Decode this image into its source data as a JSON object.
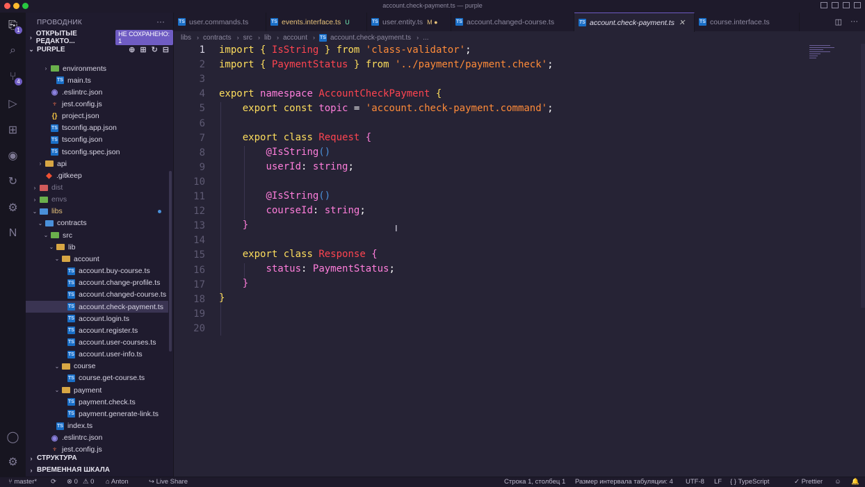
{
  "window": {
    "title": "account.check-payment.ts — purple"
  },
  "activity": {
    "items": [
      {
        "icon": "files-icon",
        "badge": "1"
      },
      {
        "icon": "search-icon"
      },
      {
        "icon": "source-control-icon",
        "badge": "4"
      },
      {
        "icon": "run-debug-icon"
      },
      {
        "icon": "extensions-icon"
      },
      {
        "icon": "github-icon"
      },
      {
        "icon": "remote-icon"
      },
      {
        "icon": "settings-sync-icon"
      },
      {
        "icon": "nx-icon"
      }
    ],
    "bottom": [
      {
        "icon": "account-icon"
      },
      {
        "icon": "manage-gear-icon"
      }
    ]
  },
  "sidebar": {
    "title": "ПРОВОДНИК",
    "more": "···",
    "open_editors": {
      "label": "ОТКРЫТЫЕ РЕДАКТО...",
      "badge": "НЕ СОХРАНЕНО: 1"
    },
    "workspace": {
      "label": "PURPLE"
    },
    "tree": [
      {
        "name": "environments",
        "type": "folder",
        "color": "green",
        "indent": 2,
        "twisty": "›"
      },
      {
        "name": "main.ts",
        "type": "ts",
        "indent": 3
      },
      {
        "name": ".eslintrc.json",
        "type": "eslint",
        "indent": 2
      },
      {
        "name": "jest.config.js",
        "type": "js",
        "indent": 2
      },
      {
        "name": "project.json",
        "type": "json",
        "indent": 2
      },
      {
        "name": "tsconfig.app.json",
        "type": "ts",
        "indent": 2
      },
      {
        "name": "tsconfig.json",
        "type": "ts",
        "indent": 2
      },
      {
        "name": "tsconfig.spec.json",
        "type": "ts",
        "indent": 2
      },
      {
        "name": "api",
        "type": "folder",
        "color": "",
        "indent": 1,
        "twisty": "›"
      },
      {
        "name": ".gitkeep",
        "type": "git",
        "indent": 1
      },
      {
        "name": "dist",
        "type": "folder",
        "color": "red",
        "indent": 0,
        "twisty": "›",
        "dim": true
      },
      {
        "name": "envs",
        "type": "folder",
        "color": "green",
        "indent": 0,
        "twisty": "›",
        "dim": true
      },
      {
        "name": "libs",
        "type": "folder",
        "color": "blue",
        "indent": 0,
        "twisty": "⌄",
        "mod": true,
        "dot": true
      },
      {
        "name": "contracts",
        "type": "folder",
        "color": "blue",
        "indent": 1,
        "twisty": "⌄"
      },
      {
        "name": "src",
        "type": "folder",
        "color": "green",
        "indent": 2,
        "twisty": "⌄"
      },
      {
        "name": "lib",
        "type": "folder",
        "color": "",
        "indent": 3,
        "twisty": "⌄"
      },
      {
        "name": "account",
        "type": "folder",
        "color": "",
        "indent": 4,
        "twisty": "⌄"
      },
      {
        "name": "account.buy-course.ts",
        "type": "ts",
        "indent": 5
      },
      {
        "name": "account.change-profile.ts",
        "type": "ts",
        "indent": 5
      },
      {
        "name": "account.changed-course.ts",
        "type": "ts",
        "indent": 5
      },
      {
        "name": "account.check-payment.ts",
        "type": "ts",
        "indent": 5,
        "selected": true
      },
      {
        "name": "account.login.ts",
        "type": "ts",
        "indent": 5
      },
      {
        "name": "account.register.ts",
        "type": "ts",
        "indent": 5
      },
      {
        "name": "account.user-courses.ts",
        "type": "ts",
        "indent": 5
      },
      {
        "name": "account.user-info.ts",
        "type": "ts",
        "indent": 5
      },
      {
        "name": "course",
        "type": "folder",
        "color": "",
        "indent": 4,
        "twisty": "⌄"
      },
      {
        "name": "course.get-course.ts",
        "type": "ts",
        "indent": 5
      },
      {
        "name": "payment",
        "type": "folder",
        "color": "",
        "indent": 4,
        "twisty": "⌄"
      },
      {
        "name": "payment.check.ts",
        "type": "ts",
        "indent": 5
      },
      {
        "name": "payment.generate-link.ts",
        "type": "ts",
        "indent": 5
      },
      {
        "name": "index.ts",
        "type": "ts",
        "indent": 3
      },
      {
        "name": ".eslintrc.json",
        "type": "eslint",
        "indent": 2
      },
      {
        "name": "jest.config.js",
        "type": "js",
        "indent": 2
      }
    ],
    "outline": "СТРУКТУРА",
    "timeline": "ВРЕМЕННАЯ ШКАЛА"
  },
  "tabs": [
    {
      "label": "user.commands.ts",
      "flag": ""
    },
    {
      "label": "events.interface.ts",
      "flag": "U",
      "flag_class": "u"
    },
    {
      "label": "user.entity.ts",
      "flag": "M ●",
      "flag_class": "m"
    },
    {
      "label": "account.changed-course.ts",
      "flag": ""
    },
    {
      "label": "account.check-payment.ts",
      "flag": "✕",
      "flag_class": "x",
      "active": true
    },
    {
      "label": "course.interface.ts",
      "flag": ""
    }
  ],
  "breadcrumb": [
    "libs",
    "contracts",
    "src",
    "lib",
    "account",
    "account.check-payment.ts",
    "..."
  ],
  "editor": {
    "line_numbers": [
      "1",
      "2",
      "3",
      "4",
      "5",
      "6",
      "7",
      "8",
      "9",
      "10",
      "11",
      "12",
      "13",
      "14",
      "15",
      "16",
      "17",
      "18",
      "19",
      "20"
    ],
    "current_line": 1
  },
  "statusbar": {
    "branch": "master*",
    "sync": "⟳",
    "errors": "⊗ 0",
    "warnings": "⚠ 0",
    "user": "Anton",
    "live_share": "Live Share",
    "position": "Строка 1, столбец 1",
    "indent": "Размер интервала табуляции: 4",
    "encoding": "UTF-8",
    "eol": "LF",
    "language": "TypeScript",
    "prettier": "✓ Prettier"
  }
}
